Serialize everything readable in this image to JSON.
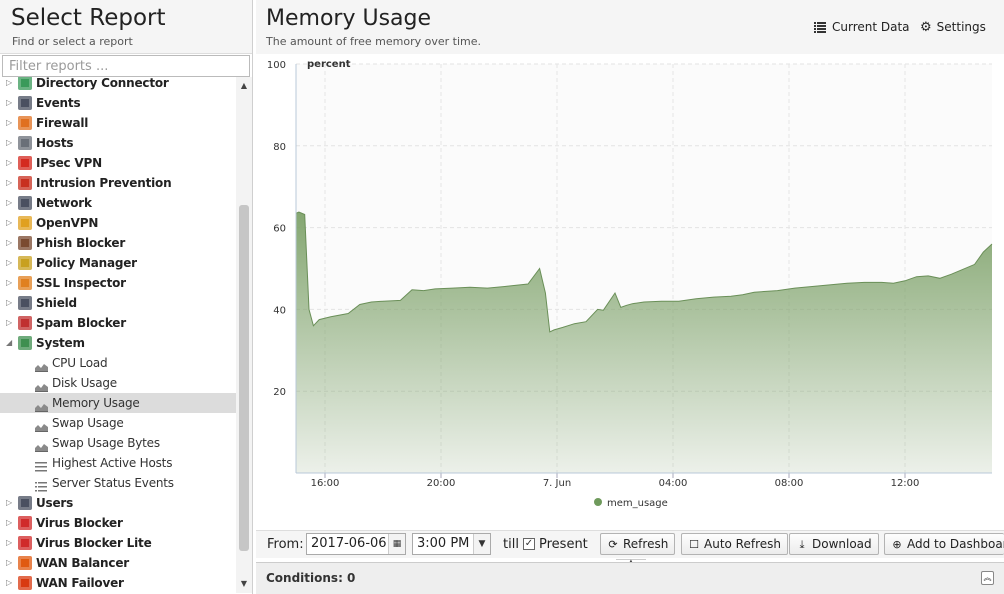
{
  "left_panel": {
    "title": "Select Report",
    "subtitle": "Find or select a report",
    "filter_placeholder": "Filter reports ..."
  },
  "tree": [
    {
      "label": "Directory Connector",
      "icon": "directory-connector-icon",
      "color": "#3a9a5a",
      "expanded": false
    },
    {
      "label": "Events",
      "icon": "events-icon",
      "color": "#4a5060",
      "expanded": false
    },
    {
      "label": "Firewall",
      "icon": "firewall-icon",
      "color": "#e07020",
      "expanded": false
    },
    {
      "label": "Hosts",
      "icon": "hosts-icon",
      "color": "#6a6f78",
      "expanded": false
    },
    {
      "label": "IPsec VPN",
      "icon": "lock-icon",
      "color": "#d42a20",
      "expanded": false
    },
    {
      "label": "Intrusion Prevention",
      "icon": "intrusion-prevention-icon",
      "color": "#c83020",
      "expanded": false
    },
    {
      "label": "Network",
      "icon": "network-icon",
      "color": "#4a5060",
      "expanded": false
    },
    {
      "label": "OpenVPN",
      "icon": "openvpn-icon",
      "color": "#e0a020",
      "expanded": false
    },
    {
      "label": "Phish Blocker",
      "icon": "phish-blocker-icon",
      "color": "#7a4a30",
      "expanded": false
    },
    {
      "label": "Policy Manager",
      "icon": "policy-manager-icon",
      "color": "#c8a020",
      "expanded": false
    },
    {
      "label": "SSL Inspector",
      "icon": "ssl-inspector-icon",
      "color": "#e08020",
      "expanded": false
    },
    {
      "label": "Shield",
      "icon": "shield-icon",
      "color": "#4a5060",
      "expanded": false
    },
    {
      "label": "Spam Blocker",
      "icon": "spam-blocker-icon",
      "color": "#c03030",
      "expanded": false
    },
    {
      "label": "System",
      "icon": "system-icon",
      "color": "#3f8f50",
      "expanded": true,
      "children": [
        {
          "label": "CPU Load",
          "icon": "area-chart-icon",
          "selected": false
        },
        {
          "label": "Disk Usage",
          "icon": "area-chart-icon",
          "selected": false
        },
        {
          "label": "Memory Usage",
          "icon": "area-chart-icon",
          "selected": true
        },
        {
          "label": "Swap Usage",
          "icon": "area-chart-icon",
          "selected": false
        },
        {
          "label": "Swap Usage Bytes",
          "icon": "area-chart-icon",
          "selected": false
        },
        {
          "label": "Highest Active Hosts",
          "icon": "list-icon",
          "selected": false
        },
        {
          "label": "Server Status Events",
          "icon": "bullet-list-icon",
          "selected": false
        }
      ]
    },
    {
      "label": "Users",
      "icon": "users-icon",
      "color": "#4a5060",
      "expanded": false
    },
    {
      "label": "Virus Blocker",
      "icon": "virus-blocker-icon",
      "color": "#d02a2a",
      "expanded": false
    },
    {
      "label": "Virus Blocker Lite",
      "icon": "virus-blocker-lite-icon",
      "color": "#d02a2a",
      "expanded": false
    },
    {
      "label": "WAN Balancer",
      "icon": "wan-balancer-icon",
      "color": "#e05a10",
      "expanded": false
    },
    {
      "label": "WAN Failover",
      "icon": "wan-failover-icon",
      "color": "#d83a10",
      "expanded": false
    }
  ],
  "report": {
    "title": "Memory Usage",
    "subtitle": "The amount of free memory over time.",
    "current_data_label": "Current Data",
    "settings_label": "Settings"
  },
  "chart_data": {
    "type": "area",
    "title": "",
    "ylabel": "percent",
    "ylim": [
      0,
      100
    ],
    "yticks": [
      20,
      40,
      60,
      80,
      100
    ],
    "xticks": [
      "16:00",
      "20:00",
      "7. Jun",
      "04:00",
      "08:00",
      "12:00"
    ],
    "xlim_hours": [
      15.0,
      39.0
    ],
    "grid": true,
    "legend_position": "bottom-center",
    "color": "#7ea26a",
    "series": [
      {
        "name": "mem_usage",
        "x_hours": [
          15.0,
          15.1,
          15.3,
          15.45,
          15.6,
          15.8,
          16.2,
          16.8,
          17.2,
          17.6,
          18.0,
          18.6,
          19.0,
          19.4,
          19.8,
          20.4,
          21.0,
          21.6,
          22.2,
          23.0,
          23.4,
          23.6,
          23.75,
          23.9,
          24.2,
          24.6,
          25.0,
          25.4,
          25.6,
          26.0,
          26.2,
          26.4,
          26.6,
          27.0,
          27.6,
          28.2,
          28.8,
          29.4,
          30.0,
          30.4,
          30.8,
          31.2,
          31.6,
          32.2,
          32.8,
          33.4,
          34.0,
          34.6,
          35.2,
          35.6,
          36.0,
          36.4,
          36.8,
          37.2,
          37.6,
          38.0,
          38.4,
          38.7,
          39.0
        ],
        "values": [
          63.5,
          63.8,
          63.2,
          40.0,
          36.0,
          37.5,
          38.2,
          39.0,
          41.2,
          41.8,
          42.0,
          42.2,
          44.8,
          44.6,
          45.0,
          45.2,
          45.4,
          45.2,
          45.6,
          46.2,
          50.0,
          44.0,
          34.5,
          35.0,
          35.6,
          36.5,
          37.0,
          40.0,
          39.8,
          44.0,
          40.5,
          41.0,
          41.4,
          41.8,
          42.0,
          42.0,
          42.6,
          43.0,
          43.2,
          43.6,
          44.2,
          44.4,
          44.6,
          45.2,
          45.6,
          46.0,
          46.4,
          46.6,
          46.6,
          46.4,
          47.0,
          48.0,
          48.2,
          47.6,
          48.6,
          49.8,
          51.0,
          54.0,
          56.0
        ]
      }
    ]
  },
  "toolbar": {
    "from_label": "From:",
    "date_value": "2017-06-06",
    "time_value": "3:00 PM",
    "till_label": "till",
    "present_label": "Present",
    "present_checked": true,
    "refresh_label": "Refresh",
    "auto_refresh_label": "Auto Refresh",
    "download_label": "Download",
    "add_dashboard_label": "Add to Dashboar"
  },
  "conditions": {
    "label": "Conditions: 0"
  }
}
